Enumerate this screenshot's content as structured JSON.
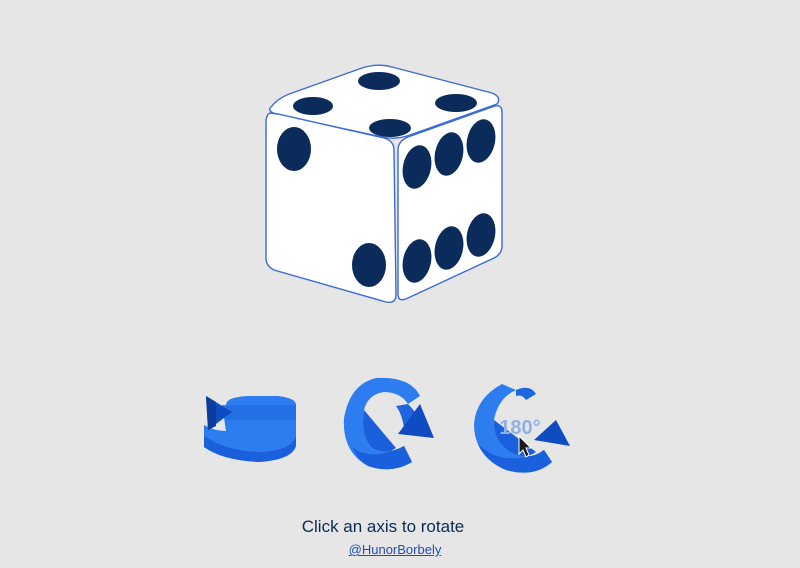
{
  "instruction": "Click an axis to rotate",
  "credit": "@HunorBorbely",
  "dice": {
    "top_face_pips": 4,
    "left_face_pips": 2,
    "right_face_pips": 6,
    "face_color": "#ffffff",
    "pip_color": "#0b2b5a",
    "outline_color": "#3a6bd6"
  },
  "axes": [
    {
      "id": "y-axis",
      "icon": "rotate-horizontal-arrow-icon"
    },
    {
      "id": "x-axis",
      "icon": "rotate-vertical-arrow-icon"
    },
    {
      "id": "z-axis",
      "icon": "rotate-180-arrow-icon",
      "badge": "180°"
    }
  ],
  "colors": {
    "background": "#e6e6e6",
    "arrow_light": "#2d7cf0",
    "arrow_dark": "#0f4cc2",
    "text": "#0d2a55",
    "link": "#1f4fb8"
  }
}
